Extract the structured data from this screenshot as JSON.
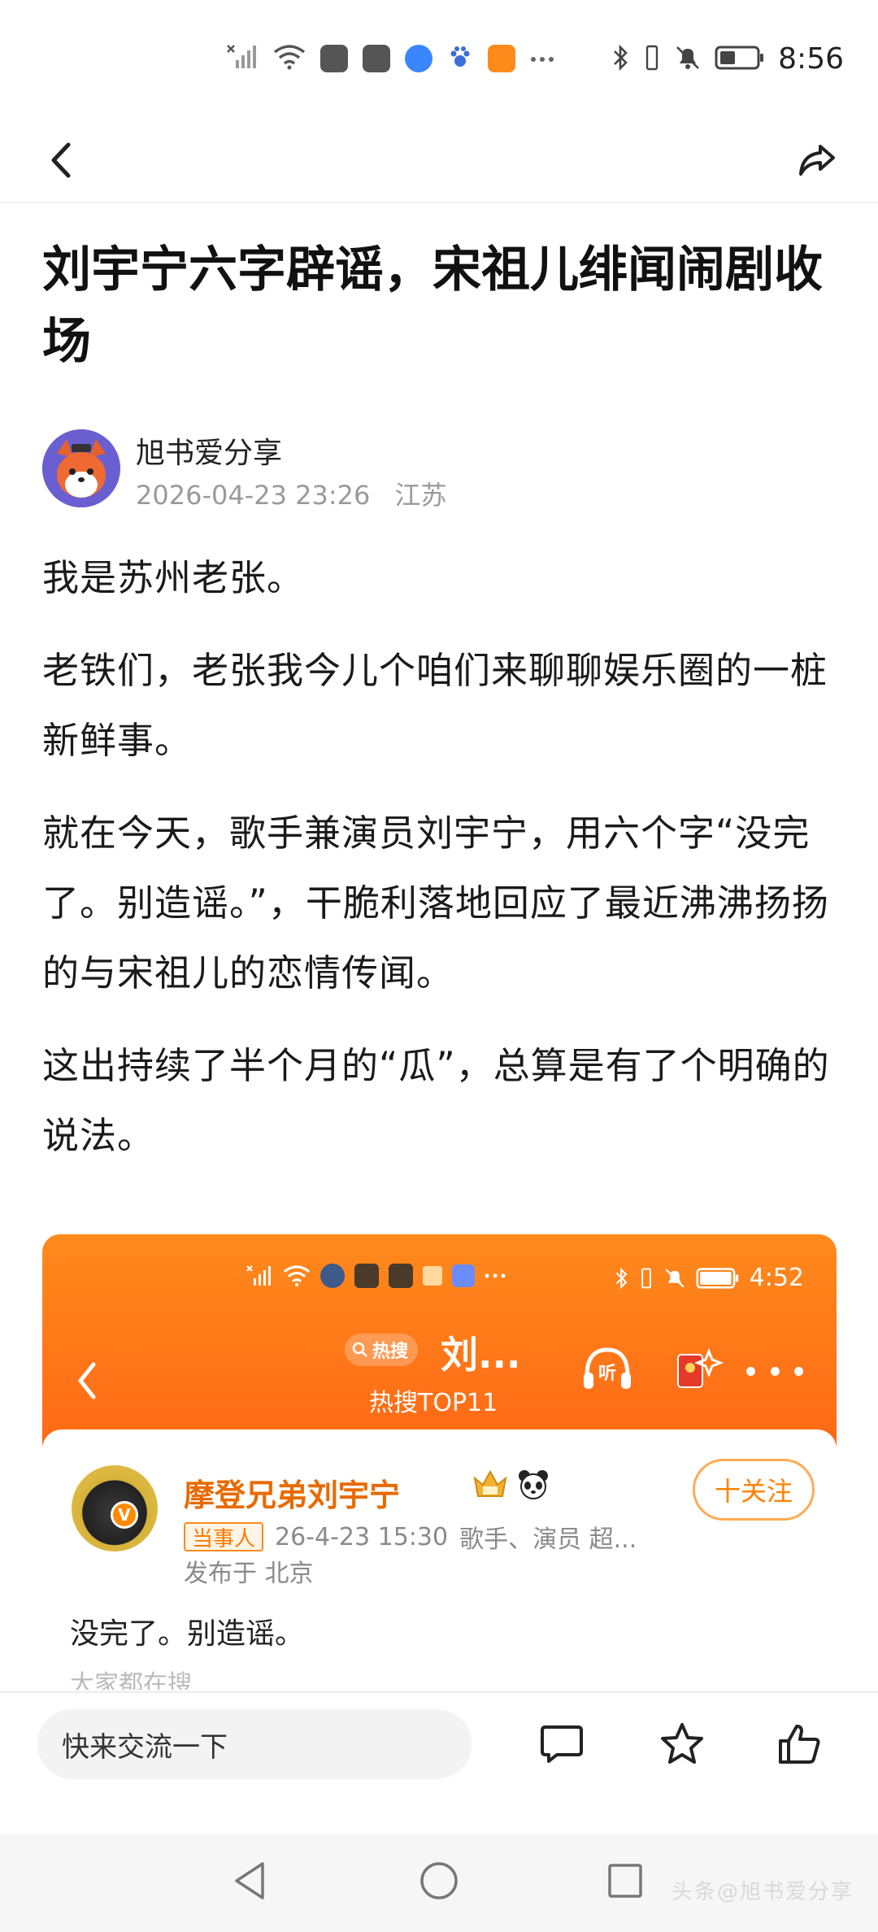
{
  "status_bar": {
    "time": "8:56",
    "icons": [
      "no-signal-icon",
      "wifi-icon",
      "app-icon",
      "app-icon",
      "browser-icon",
      "paw-icon",
      "video-app-icon",
      "more-dots-icon",
      "bluetooth-icon",
      "vibrate-icon",
      "mute-icon",
      "battery-icon"
    ]
  },
  "navbar": {
    "back_icon": "chevron-left-icon",
    "share_icon": "share-icon"
  },
  "article": {
    "title": "刘宇宁六字辟谣，宋祖儿绯闻闹剧收场",
    "author": {
      "name": "旭书爱分享",
      "date": "2026-04-23 23:26",
      "location": "江苏"
    },
    "paragraphs": [
      "我是苏州老张。",
      "老铁们，老张我今儿个咱们来聊聊娱乐圈的一桩新鲜事。",
      "就在今天，歌手兼演员刘宇宁，用六个字“没完了。别造谣。”，干脆利落地回应了最近沸沸扬扬的与宋祖儿的恋情传闻。",
      "这出持续了半个月的“瓜”，总算是有了个明确的说法。"
    ]
  },
  "embed": {
    "time": "4:52",
    "search_tag": "热搜",
    "topic": "刘...",
    "sub": "热搜TOP11",
    "listen_label": "听",
    "user": {
      "name": "摩登兄弟刘宇宁",
      "tag": "当事人",
      "time": "26-4-23 15:30",
      "desc": "歌手、演员 超...",
      "location": "发布于 北京",
      "verified_badge": "V"
    },
    "follow_label": "十关注",
    "post_text": "没完了。别造谣。",
    "cut_text": "大家都在搜"
  },
  "bottom_bar": {
    "comment_placeholder": "快来交流一下",
    "icons": [
      "comment-icon",
      "star-icon",
      "thumbs-up-icon"
    ]
  },
  "system_nav": {
    "icons": [
      "back-triangle-icon",
      "home-circle-icon",
      "recents-square-icon"
    ],
    "watermark": "头条@旭书爱分享"
  },
  "colors": {
    "accent_orange": "#ff6a16",
    "follow_orange": "#ff8200",
    "name_orange": "#e86a00"
  }
}
